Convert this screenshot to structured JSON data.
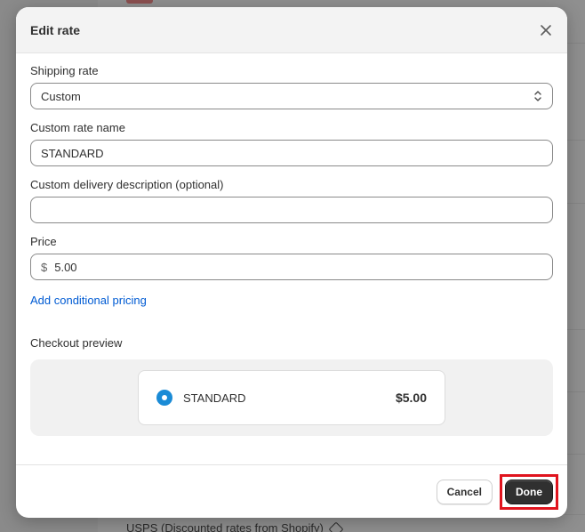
{
  "background": {
    "partial_text": "USPS (Discounted rates from Shopify)"
  },
  "modal": {
    "title": "Edit rate",
    "close_icon": "close-icon",
    "shipping_rate": {
      "label": "Shipping rate",
      "value": "Custom",
      "icon": "select-chevron-icon"
    },
    "custom_rate_name": {
      "label": "Custom rate name",
      "value": "STANDARD"
    },
    "custom_delivery_description": {
      "label": "Custom delivery description (optional)",
      "value": ""
    },
    "price": {
      "label": "Price",
      "prefix": "$",
      "value": "5.00"
    },
    "add_conditional_pricing": "Add conditional pricing",
    "checkout_preview": {
      "label": "Checkout preview",
      "option_name": "STANDARD",
      "option_price": "$5.00",
      "radio_color": "#1a8bd6"
    },
    "footer": {
      "cancel_label": "Cancel",
      "done_label": "Done",
      "highlight_color": "#e0141e"
    }
  },
  "colors": {
    "link": "#005bd3",
    "primary_button": "#303030",
    "overlay": "#8a8a8a"
  }
}
